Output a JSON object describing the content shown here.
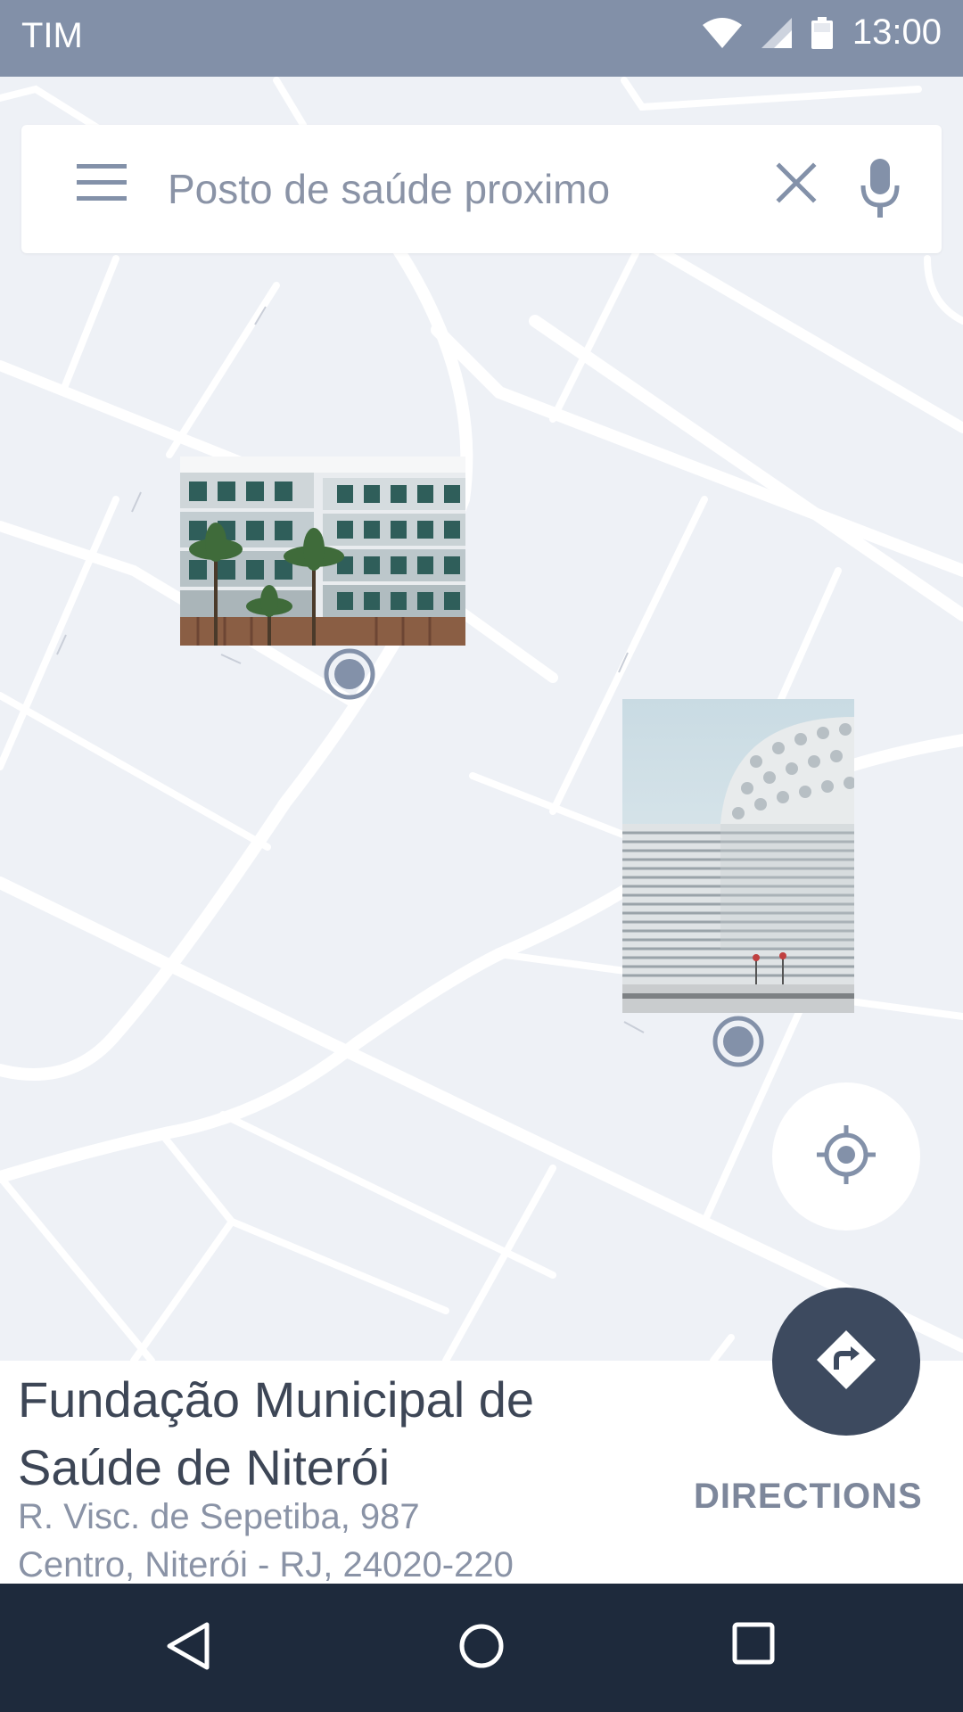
{
  "status_bar": {
    "carrier": "TIM",
    "time": "13:00",
    "icons": [
      "wifi-icon",
      "signal-icon",
      "battery-icon"
    ]
  },
  "search": {
    "placeholder": "Posto de saúde proximo",
    "value": "",
    "icons": [
      "menu-icon",
      "clear-icon",
      "mic-icon"
    ]
  },
  "map": {
    "markers": [
      {
        "name": "hotel-building-photo",
        "icon": "location-pin-icon"
      },
      {
        "name": "modern-building-photo",
        "icon": "location-pin-icon"
      }
    ],
    "locate_icon": "my-location-icon"
  },
  "place": {
    "name": "Fundação Municipal de Saúde de Niterói",
    "address_line1": "R. Visc. de Sepetiba, 987",
    "address_line2": "Centro, Niterói - RJ, 24020-220"
  },
  "actions": {
    "directions_label": "DIRECTIONS",
    "directions_icon": "directions-icon"
  },
  "nav": {
    "icons": [
      "back-icon",
      "home-icon",
      "recents-icon"
    ]
  },
  "colors": {
    "status_bar": "#8290a8",
    "map_bg": "#eef1f6",
    "road": "#ffffff",
    "accent_dark": "#3d4a5f",
    "nav_bar": "#1e2a3c",
    "text_primary": "#3d4656",
    "text_secondary": "#8a93a6"
  }
}
